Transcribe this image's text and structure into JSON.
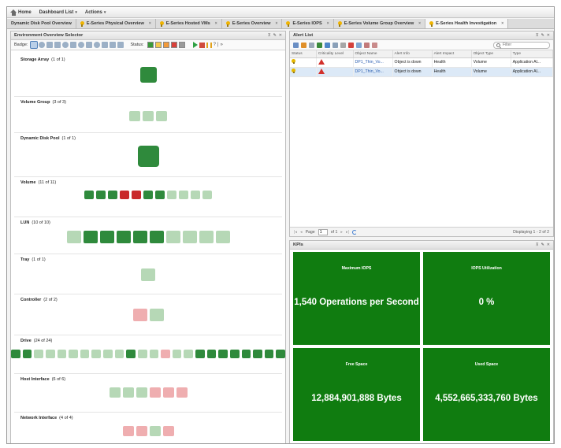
{
  "menubar": {
    "items": [
      {
        "label": "Home"
      },
      {
        "label": "Dashboard List"
      },
      {
        "label": "Actions"
      }
    ]
  },
  "tabs": [
    {
      "label": "Dynamic Disk Pool Overview",
      "icon": "bulb-icon",
      "active": false,
      "closable": false
    },
    {
      "label": "E-Series Physical Overview",
      "icon": "bulb-icon",
      "active": false,
      "closable": true
    },
    {
      "label": "E-Series Hosted VMs",
      "icon": "bulb-icon",
      "active": false,
      "closable": true
    },
    {
      "label": "E-Series Overview",
      "icon": "bulb-icon",
      "active": false,
      "closable": true
    },
    {
      "label": "E-Series IOPS",
      "icon": "bulb-icon",
      "active": false,
      "closable": true
    },
    {
      "label": "E-Series Volume Group Overview",
      "icon": "bulb-icon",
      "active": false,
      "closable": true
    },
    {
      "label": "E-Series Health Investigation",
      "icon": "bulb-icon",
      "active": true,
      "closable": true
    }
  ],
  "env_panel": {
    "title": "Environment Overview Selector",
    "badge_label": "Badge:",
    "status_label": "Status:",
    "status_colors": [
      "#3a9a3a",
      "#f2c94c",
      "#f29a3a",
      "#d9403a",
      "#9a9a9a"
    ],
    "tools": [
      "pin-icon",
      "edit-icon",
      "close-icon"
    ],
    "categories": [
      {
        "name": "Storage Array",
        "count": "(1 of 1)",
        "tiles": [
          "dark"
        ]
      },
      {
        "name": "Volume Group",
        "count": "(3 of 3)",
        "tiles": [
          "light",
          "light",
          "light"
        ]
      },
      {
        "name": "Dynamic Disk Pool",
        "count": "(1 of 1)",
        "tiles": [
          "dark"
        ]
      },
      {
        "name": "Volume",
        "count": "(11 of 11)",
        "tiles": [
          "dark",
          "dark",
          "dark",
          "red",
          "red",
          "dark",
          "dark",
          "light",
          "light",
          "light",
          "light"
        ]
      },
      {
        "name": "LUN",
        "count": "(10 of 10)",
        "tiles": [
          "light",
          "dark",
          "dark",
          "dark",
          "dark",
          "dark",
          "light",
          "light",
          "light",
          "light"
        ]
      },
      {
        "name": "Tray",
        "count": "(1 of 1)",
        "tiles": [
          "light"
        ]
      },
      {
        "name": "Controller",
        "count": "(2 of 2)",
        "tiles": [
          "pink",
          "light"
        ]
      },
      {
        "name": "Drive",
        "count": "(24 of 24)",
        "tiles": [
          "dark",
          "dark",
          "light",
          "light",
          "light",
          "light",
          "light",
          "light",
          "light",
          "light",
          "dark",
          "light",
          "light",
          "pink",
          "light",
          "light",
          "dark",
          "dark",
          "dark",
          "dark",
          "dark",
          "dark",
          "dark",
          "dark"
        ]
      },
      {
        "name": "Host Interface",
        "count": "(6 of 6)",
        "tiles": [
          "light",
          "light",
          "light",
          "pink",
          "pink",
          "pink"
        ]
      },
      {
        "name": "Network Interface",
        "count": "(4 of 4)",
        "tiles": [
          "pink",
          "pink",
          "light",
          "pink"
        ]
      }
    ]
  },
  "alert_panel": {
    "title": "Alert List",
    "filter_placeholder": "Filter",
    "columns": [
      "Status",
      "Criticality Level",
      "Object Name",
      "Alert Info",
      "Alert Impact",
      "Object Type",
      "Type"
    ],
    "rows": [
      {
        "object_name": "DP1_Thin_Vo...",
        "alert_info": "Object is down",
        "alert_impact": "Health",
        "object_type": "Volume",
        "type": "Application Al...",
        "selected": false
      },
      {
        "object_name": "DP1_Thin_Vo...",
        "alert_info": "Object is down",
        "alert_impact": "Health",
        "object_type": "Volume",
        "type": "Application Al...",
        "selected": true
      }
    ],
    "pager": {
      "page_label": "Page",
      "page_value": "1",
      "of_label": "of 1",
      "display_text": "Displaying 1 - 2 of 2"
    }
  },
  "kpi_panel": {
    "title": "KPIs",
    "tiles": [
      {
        "title": "Maximum IOPS",
        "value": "1,540 Operations per Second"
      },
      {
        "title": "IOPS Utilization",
        "value": "0 %"
      },
      {
        "title": "Free Space",
        "value": "12,884,901,888 Bytes"
      },
      {
        "title": "Used Space",
        "value": "4,552,665,333,760 Bytes"
      }
    ],
    "tile_color": "#107c10"
  },
  "colors": {
    "tile_dark": "#2f8a3c",
    "tile_light": "#b6d8b6",
    "tile_red": "#c9282a",
    "tile_pink": "#efaeb0"
  }
}
